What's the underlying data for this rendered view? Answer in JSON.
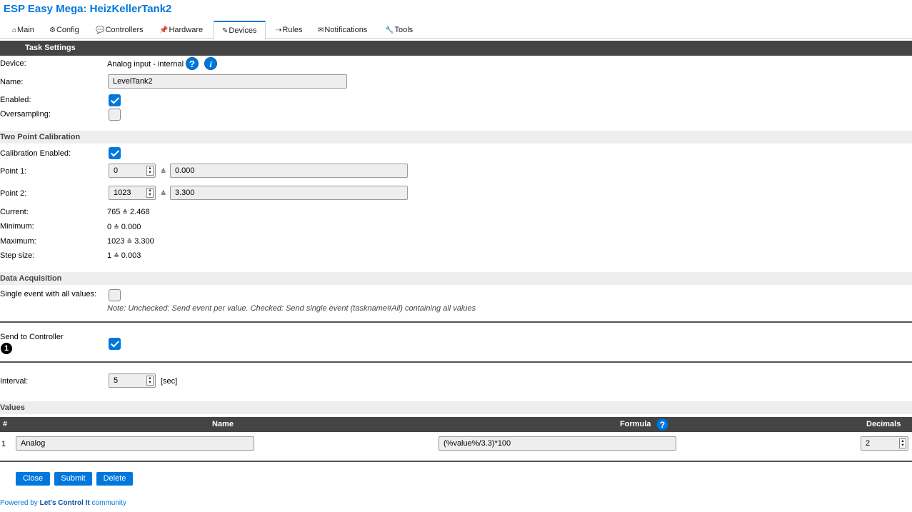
{
  "app": {
    "title": "ESP Easy Mega: HeizKellerTank2"
  },
  "tabs": [
    {
      "icon": "⌂",
      "label": "Main"
    },
    {
      "icon": "⚙",
      "label": "Config"
    },
    {
      "icon": "💬",
      "label": "Controllers"
    },
    {
      "icon": "📌",
      "label": "Hardware"
    },
    {
      "icon": "✎",
      "label": "Devices"
    },
    {
      "icon": "⇢",
      "label": "Rules"
    },
    {
      "icon": "✉",
      "label": "Notifications"
    },
    {
      "icon": "🔧",
      "label": "Tools"
    }
  ],
  "active_tab": "Devices",
  "task_settings": {
    "header": "Task Settings",
    "device_label": "Device:",
    "device_value": "Analog input - internal",
    "help_icon": "?",
    "info_icon": "i",
    "name_label": "Name:",
    "name_value": "LevelTank2",
    "enabled_label": "Enabled:",
    "enabled": true,
    "oversampling_label": "Oversampling:",
    "oversampling": false
  },
  "calibration": {
    "header": "Two Point Calibration",
    "enabled_label": "Calibration Enabled:",
    "enabled": true,
    "approx_symbol": "≙",
    "point1_label": "Point 1:",
    "point1_adc": "0",
    "point1_value": "0.000",
    "point2_label": "Point 2:",
    "point2_adc": "1023",
    "point2_value": "3.300",
    "current_label": "Current:",
    "current_adc": "765",
    "current_value": "2.468",
    "minimum_label": "Minimum:",
    "minimum_adc": "0",
    "minimum_value": "0.000",
    "maximum_label": "Maximum:",
    "maximum_adc": "1023",
    "maximum_value": "3.300",
    "step_label": "Step size:",
    "step_adc": "1",
    "step_value": "0.003"
  },
  "acquisition": {
    "header": "Data Acquisition",
    "single_event_label": "Single event with all values:",
    "single_event": false,
    "note": "Note: Unchecked: Send event per value. Checked: Send single event (taskname#All) containing all values",
    "send_label": "Send to Controller",
    "controller_number": "1",
    "send_enabled": true,
    "interval_label": "Interval:",
    "interval_value": "5",
    "interval_unit": "[sec]"
  },
  "values": {
    "header": "Values",
    "columns": {
      "num": "#",
      "name": "Name",
      "formula": "Formula",
      "decimals": "Decimals"
    },
    "rows": [
      {
        "num": "1",
        "name": "Analog",
        "formula": "(%value%/3.3)*100",
        "decimals": "2"
      }
    ]
  },
  "buttons": {
    "close": "Close",
    "submit": "Submit",
    "delete": "Delete"
  },
  "footer": {
    "prefix": "Powered by ",
    "brand": "Let's Control It",
    "suffix": " community"
  },
  "colors": {
    "accent": "#0077dd",
    "header_dark": "#444444",
    "header_light": "#eeeeee"
  }
}
